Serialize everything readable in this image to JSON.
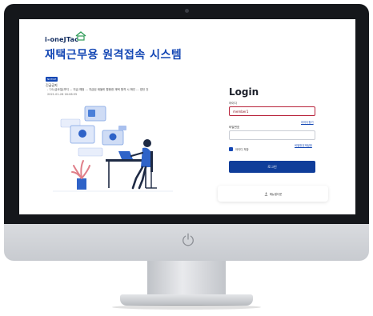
{
  "header": {
    "logo_text": "i-oneJTac",
    "title": "재택근무용 원격접속 시스템"
  },
  "notice": {
    "badge": "NOTICE",
    "title": "긴급공지",
    "body": "- 7/1(금요일)까지 ... 지급 예정 ... 지급된 태블릿 활용한 재택 원격 시 확인 ... 였던 건",
    "date": "2021-01-26 16:06:55"
  },
  "login": {
    "title": "Login",
    "id_label": "아이디",
    "id_value": "member1",
    "find_id": "아이디찾기",
    "pw_label": "비밀번호",
    "find_pw": "비밀번호재설정",
    "remember_label": "아이디 저장",
    "remember_checked": true,
    "submit_label": "로그인",
    "manual_label": "매뉴얼다운"
  },
  "colors": {
    "brand": "#1447b4",
    "button": "#0f3d9a",
    "bezel": "#15171b",
    "input_focus": "#b8233b"
  },
  "icons": {
    "power": "power-icon",
    "download": "download-icon",
    "logo_house": "house-icon"
  }
}
